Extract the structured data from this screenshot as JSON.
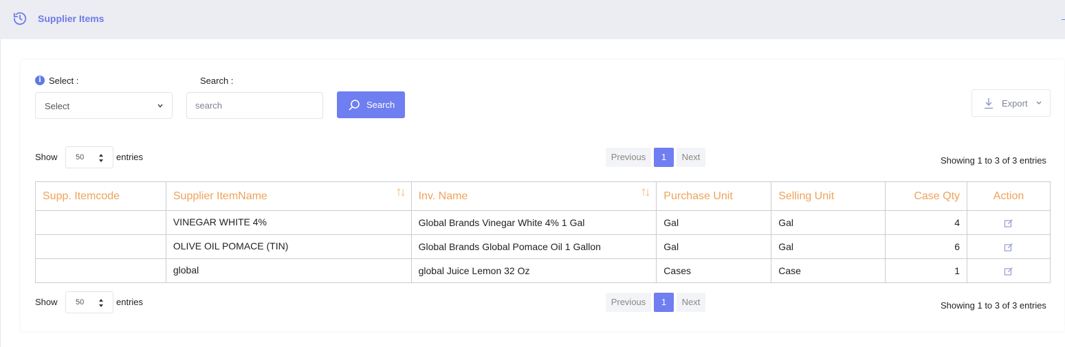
{
  "header": {
    "title": "Supplier Items",
    "icon": "history-icon"
  },
  "filters": {
    "select_label": "Select :",
    "select_value": "Select",
    "search_label": "Search :",
    "search_placeholder": "search",
    "search_button": "Search",
    "export_button": "Export"
  },
  "length": {
    "show": "Show",
    "value": "50",
    "entries": "entries"
  },
  "pager": {
    "previous": "Previous",
    "current": "1",
    "next": "Next"
  },
  "info": "Showing 1 to 3 of 3 entries",
  "table": {
    "columns": [
      "Supp. Itemcode",
      "Supplier ItemName",
      "Inv. Name",
      "Purchase Unit",
      "Selling Unit",
      "Case Qty",
      "Action"
    ],
    "rows": [
      {
        "code": "",
        "supplier_name": "VINEGAR WHITE 4%",
        "inv_name": "Global Brands Vinegar White 4% 1 Gal",
        "purchase_unit": "Gal",
        "selling_unit": "Gal",
        "case_qty": "4",
        "action": "edit-icon"
      },
      {
        "code": "",
        "supplier_name": "OLIVE OIL POMACE (TIN)",
        "inv_name": "Global Brands Global Pomace Oil 1 Gallon",
        "purchase_unit": "Gal",
        "selling_unit": "Gal",
        "case_qty": "6",
        "action": "edit-icon"
      },
      {
        "code": "",
        "supplier_name": "global",
        "inv_name": "global Juice Lemon 32 Oz",
        "purchase_unit": "Cases",
        "selling_unit": "Case",
        "case_qty": "1",
        "action": "edit-icon"
      }
    ]
  },
  "colors": {
    "accent": "#6f7ef0",
    "header_text": "#f0a25a",
    "title": "#6f7ae6"
  }
}
